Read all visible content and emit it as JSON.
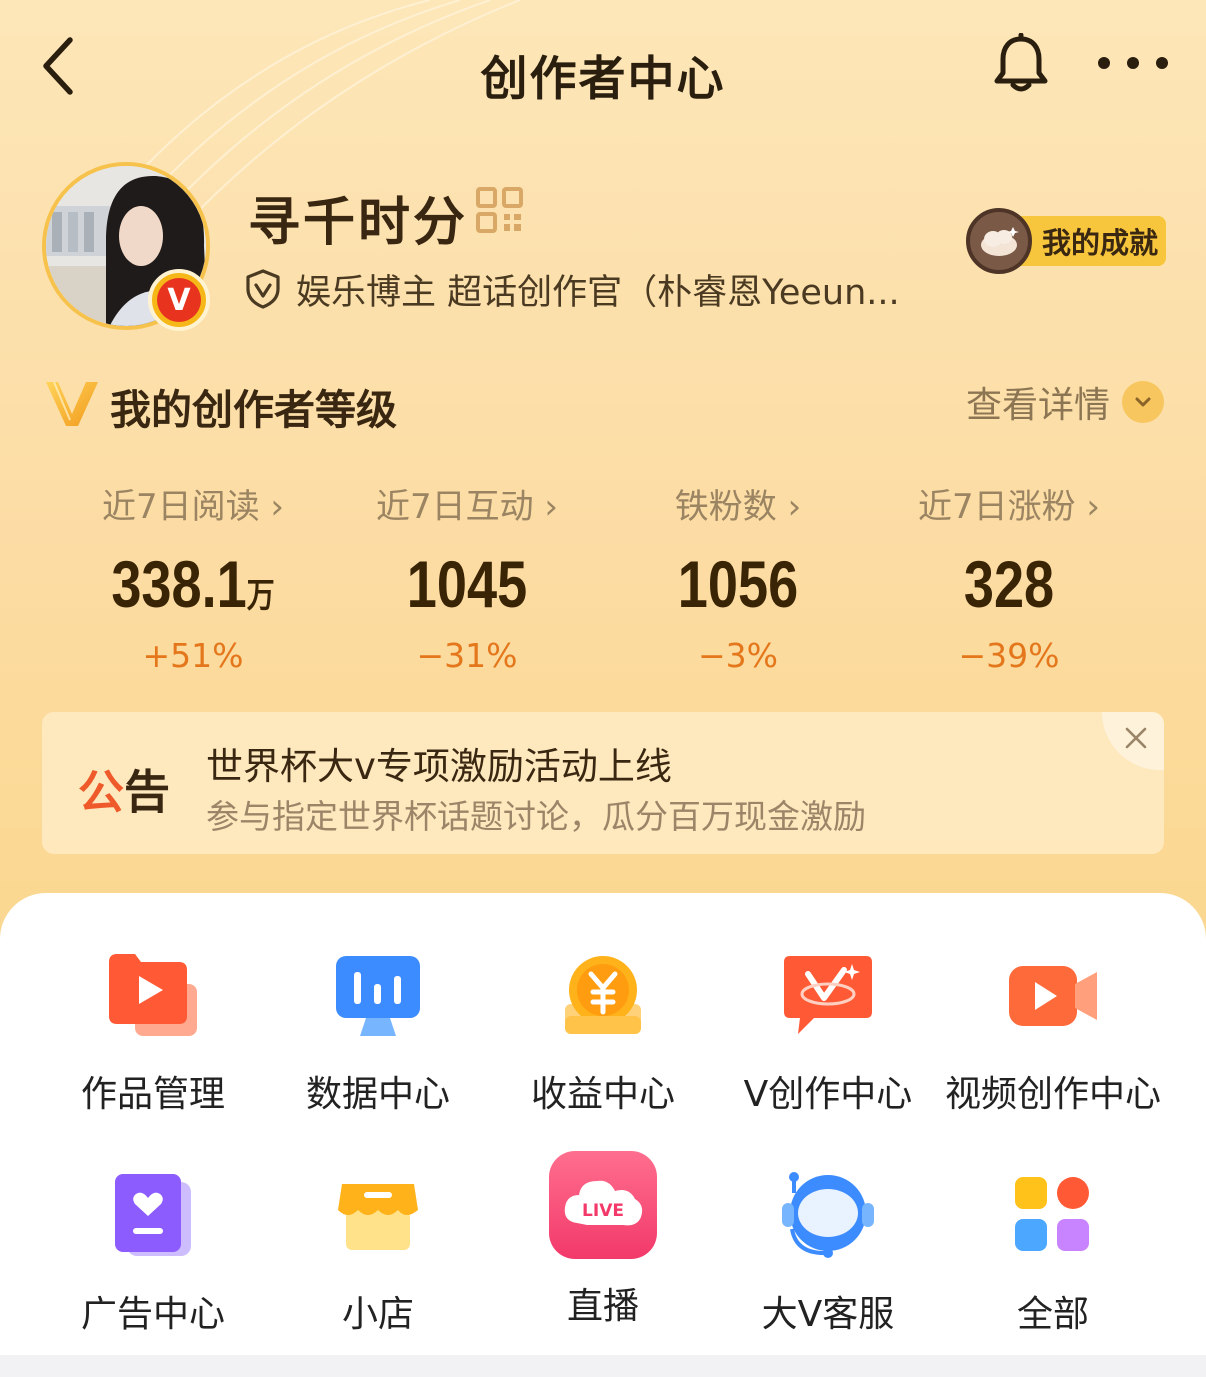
{
  "header": {
    "title": "创作者中心"
  },
  "profile": {
    "name": "寻千时分",
    "verify_text": "娱乐博主 超话创作官（朴睿恩Yeeun...",
    "badge_letter": "V",
    "achievement_label": "我的成就"
  },
  "level": {
    "title": "我的创作者等级",
    "detail_label": "查看详情"
  },
  "stats": [
    {
      "label": "近7日阅读 ›",
      "value": "338.1",
      "unit": "万",
      "change": "+51%"
    },
    {
      "label": "近7日互动 ›",
      "value": "1045",
      "unit": "",
      "change": "−31%"
    },
    {
      "label": "铁粉数 ›",
      "value": "1056",
      "unit": "",
      "change": "−3%"
    },
    {
      "label": "近7日涨粉 ›",
      "value": "328",
      "unit": "",
      "change": "−39%"
    }
  ],
  "notice": {
    "tag_first": "公",
    "tag_second": "告",
    "title": "世界杯大v专项激励活动上线",
    "subtitle": "参与指定世界杯话题讨论，瓜分百万现金激励"
  },
  "grid": [
    {
      "label": "作品管理",
      "icon": "works-manage-icon"
    },
    {
      "label": "数据中心",
      "icon": "data-center-icon"
    },
    {
      "label": "收益中心",
      "icon": "income-center-icon"
    },
    {
      "label": "V创作中心",
      "icon": "v-creation-icon"
    },
    {
      "label": "视频创作中心",
      "icon": "video-creation-icon"
    },
    {
      "label": "广告中心",
      "icon": "ad-center-icon"
    },
    {
      "label": "小店",
      "icon": "shop-icon"
    },
    {
      "label": "直播",
      "icon": "live-icon",
      "icon_text": "LIVE"
    },
    {
      "label": "大V客服",
      "icon": "customer-service-icon"
    },
    {
      "label": "全部",
      "icon": "all-apps-icon"
    }
  ],
  "colors": {
    "accent_orange": "#e4771c",
    "notice_red": "#ef5a2a",
    "badge_red": "#e8341e",
    "gold": "#f6c24c"
  }
}
